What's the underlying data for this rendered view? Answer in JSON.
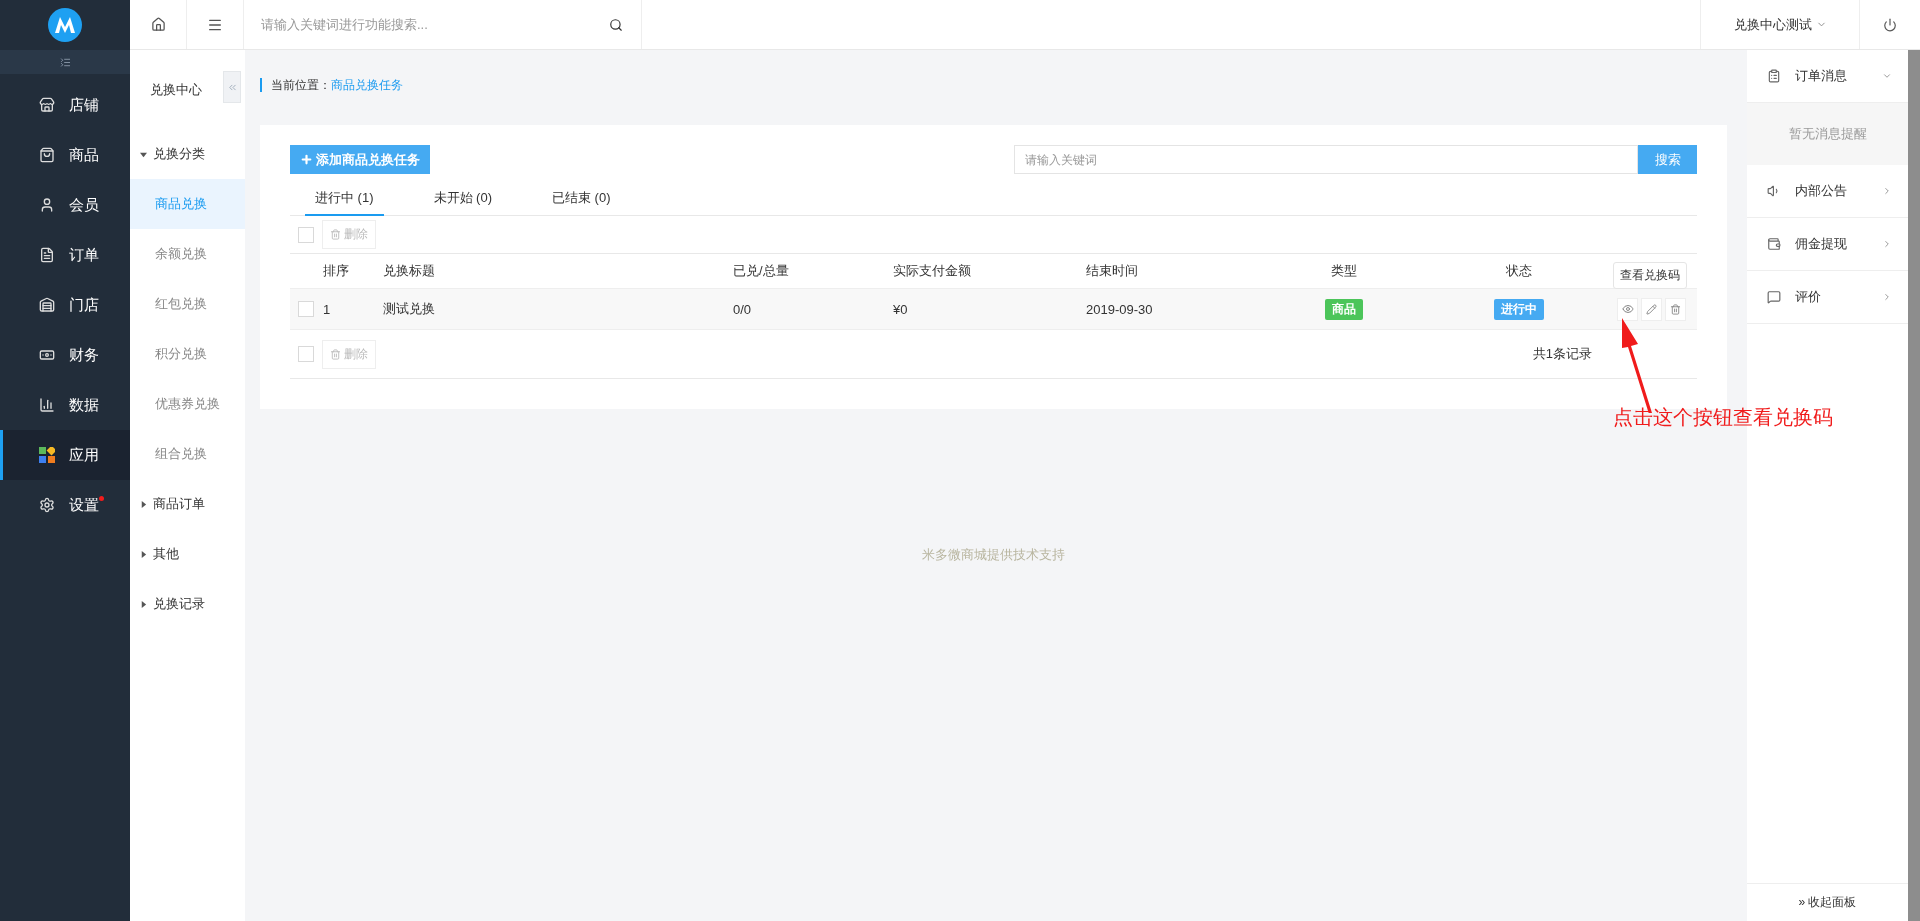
{
  "topbar": {
    "search": {
      "placeholder": "请输入关键词进行功能搜索..."
    },
    "user": "兑换中心测试"
  },
  "sidebar": {
    "items": [
      {
        "label": "店铺",
        "selected": false,
        "dot": false
      },
      {
        "label": "商品",
        "selected": false,
        "dot": false
      },
      {
        "label": "会员",
        "selected": false,
        "dot": false
      },
      {
        "label": "订单",
        "selected": false,
        "dot": false
      },
      {
        "label": "门店",
        "selected": false,
        "dot": false
      },
      {
        "label": "财务",
        "selected": false,
        "dot": false
      },
      {
        "label": "数据",
        "selected": false,
        "dot": false
      },
      {
        "label": "应用",
        "selected": true,
        "dot": false
      },
      {
        "label": "设置",
        "selected": false,
        "dot": true
      }
    ]
  },
  "subnav": {
    "title": "兑换中心",
    "groups": [
      {
        "label": "兑换分类",
        "expanded": true,
        "children": [
          {
            "label": "商品兑换",
            "selected": true
          },
          {
            "label": "余额兑换",
            "selected": false
          },
          {
            "label": "红包兑换",
            "selected": false
          },
          {
            "label": "积分兑换",
            "selected": false
          },
          {
            "label": "优惠券兑换",
            "selected": false
          },
          {
            "label": "组合兑换",
            "selected": false
          }
        ]
      },
      {
        "label": "商品订单",
        "expanded": false
      },
      {
        "label": "其他",
        "expanded": false
      },
      {
        "label": "兑换记录",
        "expanded": false
      }
    ]
  },
  "breadcrumb": {
    "label": "当前位置：",
    "current": "商品兑换任务"
  },
  "toolbar": {
    "add_button": "添加商品兑换任务",
    "search": {
      "placeholder": "请输入关键词"
    },
    "search_button": "搜索"
  },
  "tabs": [
    {
      "label": "进行中 (1)",
      "selected": true
    },
    {
      "label": "未开始 (0)",
      "selected": false
    },
    {
      "label": "已结束 (0)",
      "selected": false
    }
  ],
  "bulk_top": {
    "checked": false,
    "delete": "删除"
  },
  "table": {
    "columns": [
      "排序",
      "兑换标题",
      "已兑/总量",
      "实际支付金额",
      "结束时间",
      "类型",
      "状态"
    ],
    "rows": [
      {
        "checked": false,
        "cells": [
          "1",
          "测试兑换",
          "0/0",
          "¥0",
          "2019-09-30"
        ],
        "type": "商品",
        "status": "进行中"
      }
    ]
  },
  "tooltip": "查看兑换码",
  "bulk_bottom": {
    "checked": false,
    "delete": "删除"
  },
  "record_count": "共1条记录",
  "annotation": "点击这个按钮查看兑换码",
  "credit": "米多微商城提供技术支持",
  "right_panel": {
    "sections": [
      {
        "title": "订单消息",
        "expanded": true,
        "empty": "暂无消息提醒"
      },
      {
        "title": "内部公告",
        "expanded": false
      },
      {
        "title": "佣金提现",
        "expanded": false
      },
      {
        "title": "评价",
        "expanded": false
      }
    ],
    "collapse": "» 收起面板"
  }
}
